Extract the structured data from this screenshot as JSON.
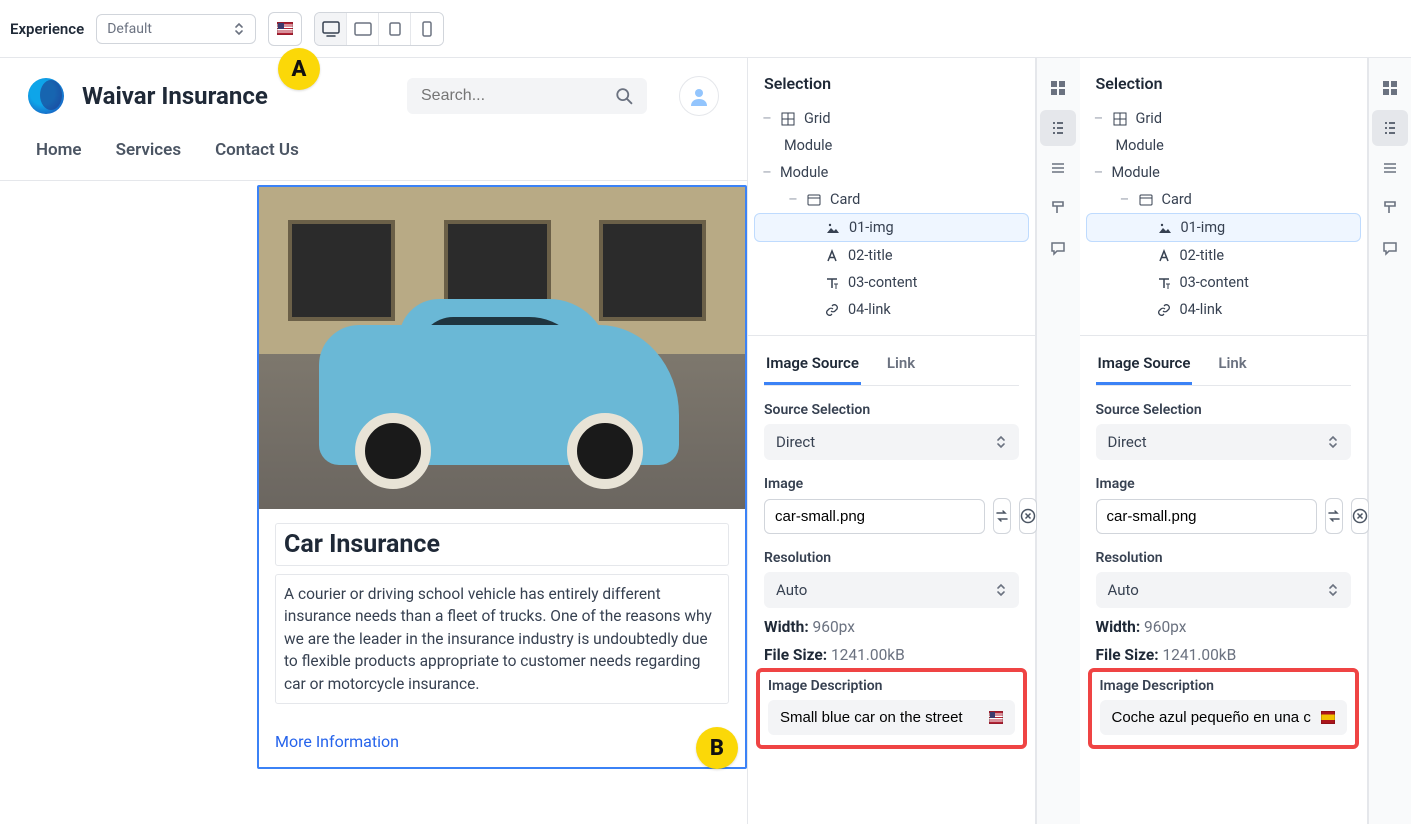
{
  "toolbar": {
    "experience_label": "Experience",
    "experience_value": "Default",
    "locale_flag": "us"
  },
  "preview": {
    "brand": "Waivar Insurance",
    "search_placeholder": "Search...",
    "nav": [
      "Home",
      "Services",
      "Contact Us"
    ],
    "card": {
      "title": "Car Insurance",
      "body": "A courier or driving school vehicle has entirely different insurance needs than a fleet of trucks. One of the reasons why we are the leader in the insurance industry is undoubtedly due to flexible products appropriate to customer needs regarding car or motorcycle insurance.",
      "link": "More Information"
    }
  },
  "panelA": {
    "title": "Selection",
    "tree": {
      "grid": "Grid",
      "module1": "Module",
      "module2": "Module",
      "card": "Card",
      "img": "01-img",
      "title": "02-title",
      "content": "03-content",
      "link": "04-link"
    },
    "tabs": {
      "image_source": "Image Source",
      "link": "Link"
    },
    "source_selection_label": "Source Selection",
    "source_selection_value": "Direct",
    "image_label": "Image",
    "image_value": "car-small.png",
    "resolution_label": "Resolution",
    "resolution_value": "Auto",
    "width_label": "Width:",
    "width_value": "960px",
    "filesize_label": "File Size:",
    "filesize_value": "1241.00kB",
    "desc_label": "Image Description",
    "desc_value": "Small blue car on the street",
    "desc_flag": "us"
  },
  "panelB": {
    "title": "Selection",
    "tree": {
      "grid": "Grid",
      "module1": "Module",
      "module2": "Module",
      "card": "Card",
      "img": "01-img",
      "title": "02-title",
      "content": "03-content",
      "link": "04-link"
    },
    "tabs": {
      "image_source": "Image Source",
      "link": "Link"
    },
    "source_selection_label": "Source Selection",
    "source_selection_value": "Direct",
    "image_label": "Image",
    "image_value": "car-small.png",
    "resolution_label": "Resolution",
    "resolution_value": "Auto",
    "width_label": "Width:",
    "width_value": "960px",
    "filesize_label": "File Size:",
    "filesize_value": "1241.00kB",
    "desc_label": "Image Description",
    "desc_value": "Coche azul pequeño en una c",
    "desc_flag": "es"
  },
  "badges": {
    "a": "A",
    "b": "B"
  }
}
